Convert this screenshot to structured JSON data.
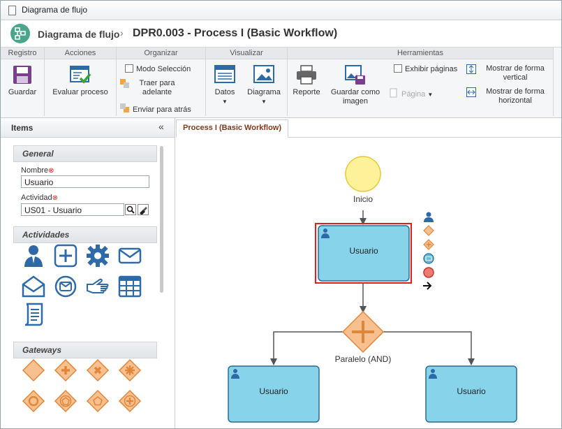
{
  "window": {
    "title": "Diagrama de flujo"
  },
  "header": {
    "app_name": "Diagrama de flujo",
    "separator": "›",
    "document_title": "DPR0.003 - Process I (Basic Workflow)"
  },
  "ribbon": {
    "registro": {
      "title": "Registro",
      "save_label": "Guardar"
    },
    "acciones": {
      "title": "Acciones",
      "evaluate_label": "Evaluar proceso"
    },
    "organizar": {
      "title": "Organizar",
      "select_mode_label": "Modo Selección",
      "bring_forward_label": "Traer para adelante",
      "send_back_label": "Enviar para atrás"
    },
    "visualizar": {
      "title": "Visualizar",
      "data_label": "Datos",
      "diagram_label": "Diagrama"
    },
    "herramientas": {
      "title": "Herramientas",
      "report_label": "Reporte",
      "save_image_label": "Guardar como imagen",
      "show_pages_label": "Exhibir páginas",
      "page_label": "Página",
      "vertical_label": "Mostrar de forma vertical",
      "horizontal_label": "Mostrar de forma horizontal"
    }
  },
  "left_panel": {
    "title": "Items",
    "collapse_glyph": "«",
    "general": {
      "title": "General",
      "name_label": "Nombre",
      "name_value": "Usuario",
      "activity_label": "Actividad",
      "activity_value": "US01 - Usuario"
    },
    "activities_title": "Actividades",
    "gateways_title": "Gateways"
  },
  "tab": {
    "label": "Process I (Basic Workflow)"
  },
  "diagram": {
    "start_label": "Inicio",
    "task_label": "Usuario",
    "gateway_label": "Paralelo (AND)",
    "left_task_label": "Usuario",
    "right_task_label": "Usuario"
  },
  "colors": {
    "accent": "#4aa58a",
    "task_fill": "#87d4ea",
    "task_stroke": "#2b6d8e",
    "gateway_fill": "#f9c08f",
    "gateway_stroke": "#e0863a",
    "selection": "#e02020",
    "start_fill": "#fdf29a",
    "icon_blue": "#2e6aa8"
  }
}
